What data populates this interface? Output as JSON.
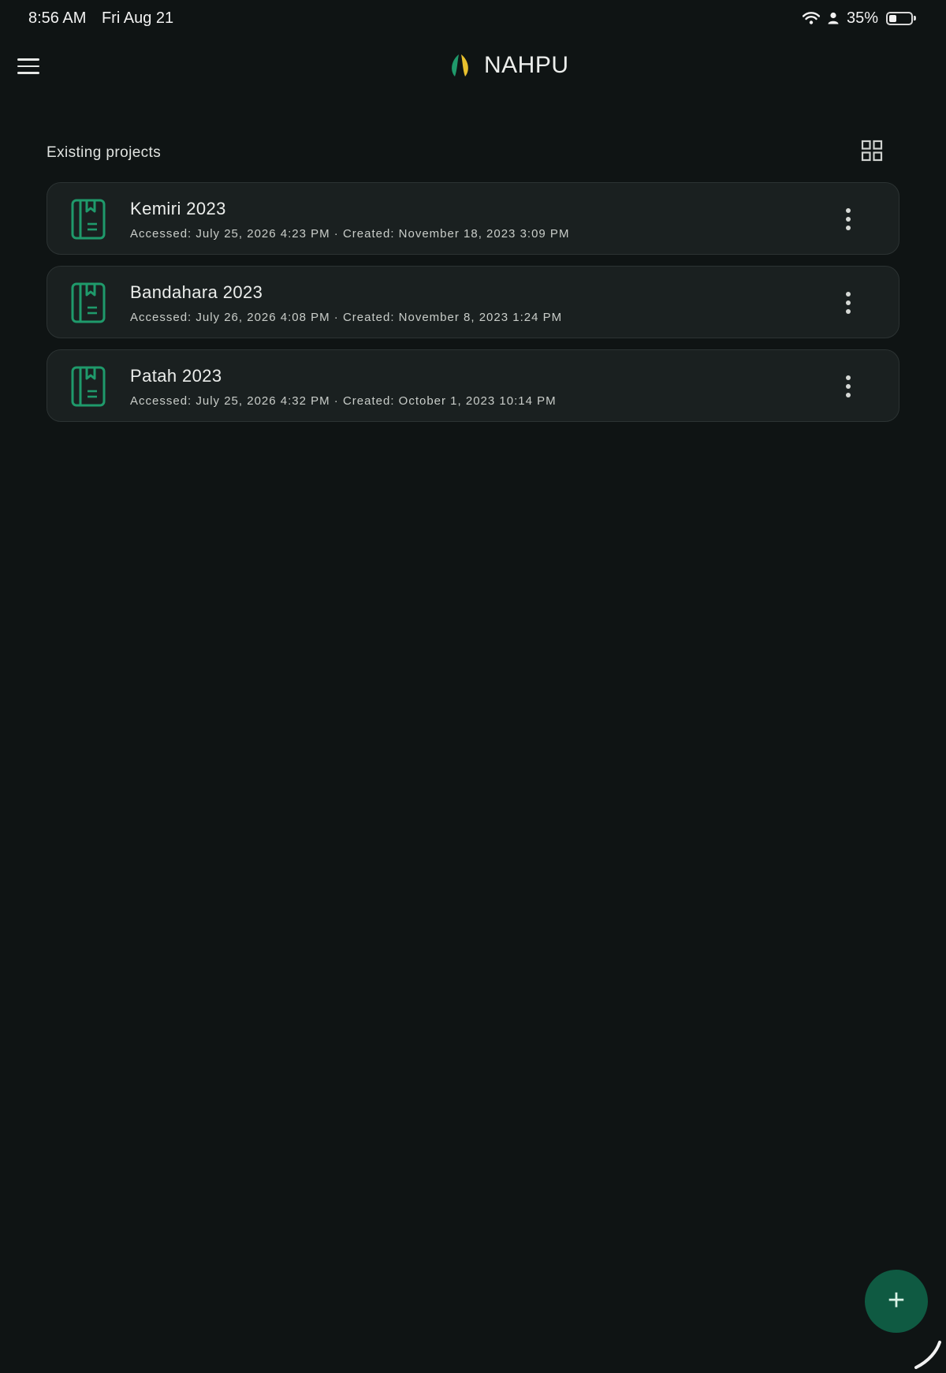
{
  "status_bar": {
    "time": "8:56 AM",
    "date": "Fri Aug 21",
    "battery_percent": "35%",
    "battery_level": 0.35,
    "icons": [
      "wifi-icon",
      "person-icon",
      "battery-icon"
    ]
  },
  "app_bar": {
    "title": "NAHPU",
    "menu_icon": "hamburger-menu-icon",
    "logo_icon": "leaf-logo-icon"
  },
  "section": {
    "title": "Existing projects",
    "view_toggle_icon": "grid-view-icon"
  },
  "projects": [
    {
      "name": "Kemiri 2023",
      "meta": "Accessed: July 25, 2026 4:23 PM · Created: November 18, 2023 3:09 PM"
    },
    {
      "name": "Bandahara 2023",
      "meta": "Accessed: July 26, 2026 4:08 PM · Created: November 8, 2023 1:24 PM"
    },
    {
      "name": "Patah 2023",
      "meta": "Accessed: July 25, 2026 4:32 PM · Created: October 1, 2023 10:14 PM"
    }
  ],
  "fab": {
    "label": "+",
    "icon": "add-icon"
  },
  "colors": {
    "background": "#0f1414",
    "card": "#1a2020",
    "accent_green": "#1f9a6b",
    "fab": "#0f5a42",
    "logo_yellow": "#e8c12e"
  }
}
